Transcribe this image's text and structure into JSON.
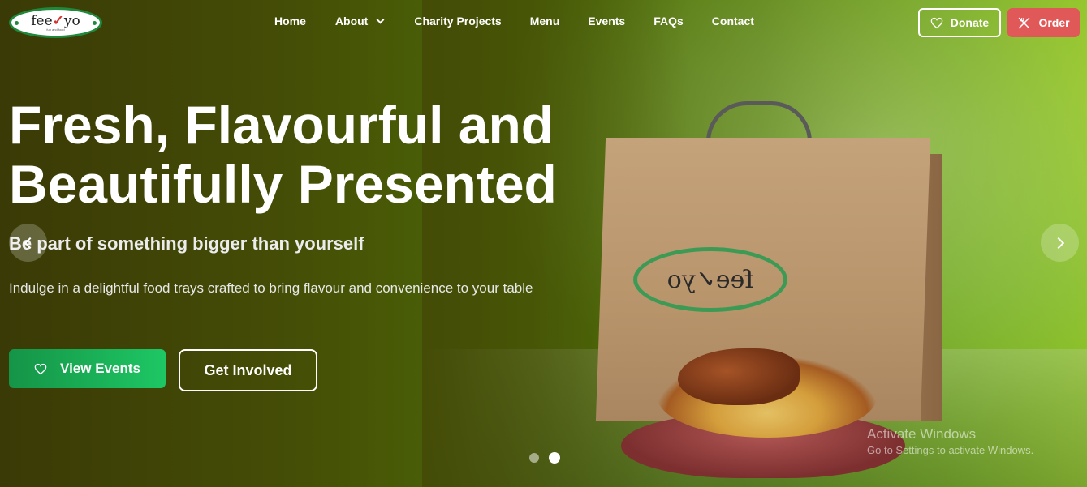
{
  "brand": {
    "name_prefix": "fee",
    "name_check": "✓",
    "name_suffix": "yo",
    "tagline": "fun and food"
  },
  "nav": {
    "items": [
      {
        "label": "Home"
      },
      {
        "label": "About"
      },
      {
        "label": "Charity Projects"
      },
      {
        "label": "Menu"
      },
      {
        "label": "Events"
      },
      {
        "label": "FAQs"
      },
      {
        "label": "Contact"
      }
    ],
    "donate_label": "Donate",
    "order_label": "Order"
  },
  "hero": {
    "headline_line1": "Fresh, Flavourful and",
    "headline_line2": "Beautifully Presented",
    "subheading": "Be part of something bigger than yourself",
    "description": "Indulge in a delightful food trays crafted to bring flavour and convenience to your table",
    "view_events_label": "View Events",
    "get_involved_label": "Get Involved",
    "bag_logo_text": "fee✓yo"
  },
  "carousel": {
    "slide_count": 2,
    "active_slide": 2
  },
  "watermark": {
    "title": "Activate Windows",
    "subtitle": "Go to Settings to activate Windows."
  },
  "colors": {
    "order_button": "#e05858",
    "events_button_start": "#159447",
    "events_button_end": "#1ec764",
    "brand_green": "#1f8a3c"
  },
  "icons": {
    "donate": "heart-icon",
    "order": "utensils-icon",
    "events": "heart-icon",
    "prev": "chevron-left-icon",
    "next": "chevron-right-icon"
  }
}
